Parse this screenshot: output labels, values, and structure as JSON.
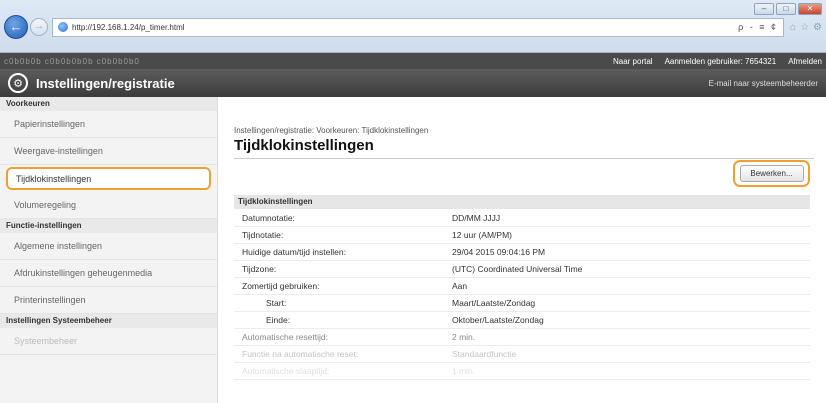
{
  "browser": {
    "url": "http://192.168.1.24/p_timer.html",
    "addr_tools": "ρ - ≡ ¢",
    "min": "–",
    "max": "□",
    "close": "✕"
  },
  "topbar": {
    "device_name": "c0b0b0b    c0b0b0b0b c0b0b0b0",
    "portal": "Naar portal",
    "logged_in": "Aanmelden gebruiker:  7654321",
    "logout": "Afmelden"
  },
  "titlebar": {
    "title": "Instellingen/registratie",
    "mail_admin": "E-mail naar systeembeheerder"
  },
  "sidebar": {
    "section1": "Voorkeuren",
    "items1": [
      "Papierinstellingen",
      "Weergave-instellingen",
      "Tijdklokinstellingen",
      "Volumeregeling"
    ],
    "section2": "Functie-instellingen",
    "items2": [
      "Algemene instellingen",
      "Afdrukinstellingen geheugenmedia",
      "Printerinstellingen"
    ],
    "section3": "Instellingen Systeembeheer",
    "items3": [
      "Systeembeheer"
    ]
  },
  "main": {
    "breadcrumb": "Instellingen/registratie: Voorkeuren: Tijdklokinstellingen",
    "title": "Tijdklokinstellingen",
    "edit_button": "Bewerken...",
    "section_title": "Tijdklokinstellingen",
    "rows": [
      {
        "key": "Datumnotatie:",
        "value": "DD/MM JJJJ"
      },
      {
        "key": "Tijdnotatie:",
        "value": "12 uur (AM/PM)"
      },
      {
        "key": "Huidige datum/tijd instellen:",
        "value": "29/04 2015 09:04:16 PM"
      },
      {
        "key": "Tijdzone:",
        "value": "(UTC) Coordinated Universal Time"
      },
      {
        "key": "Zomertijd gebruiken:",
        "value": "Aan"
      },
      {
        "key": "Start:",
        "value": "Maart/Laatste/Zondag"
      },
      {
        "key": "Einde:",
        "value": "Oktober/Laatste/Zondag"
      },
      {
        "key": "Automatische resettijd:",
        "value": "2 min."
      },
      {
        "key": "Functie na automatische reset:",
        "value": "Standaardfunctie"
      },
      {
        "key": "Automatische slaaptijd:",
        "value": "1 min."
      }
    ]
  }
}
